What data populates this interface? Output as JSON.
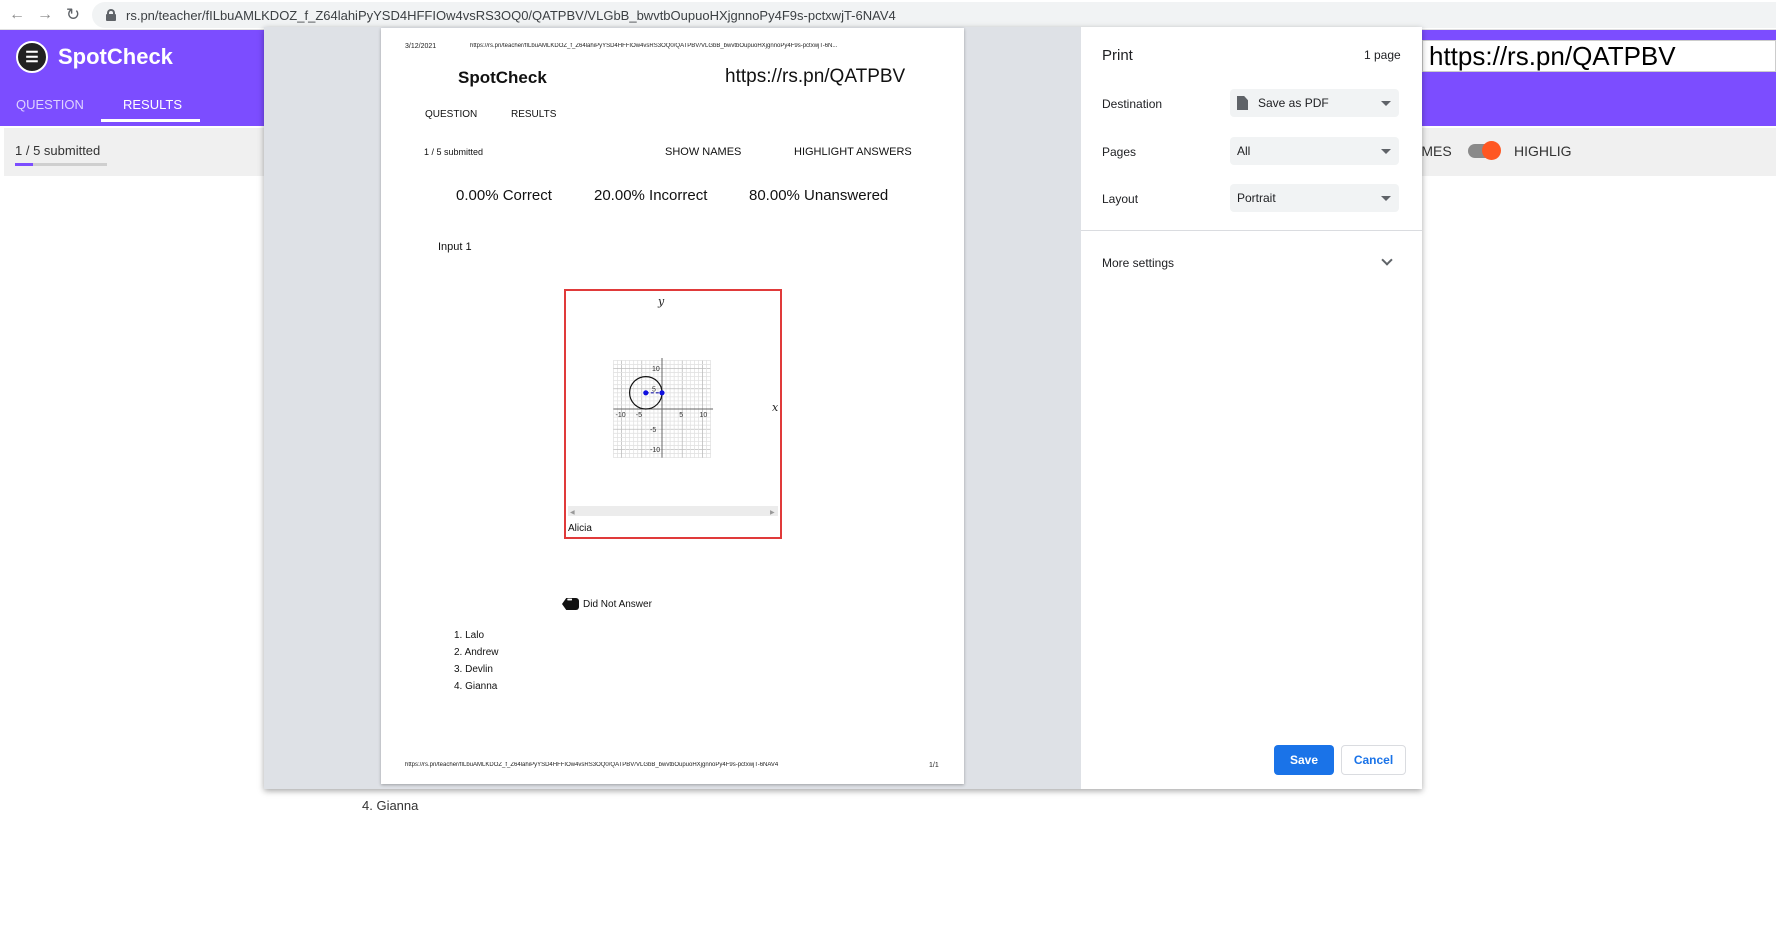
{
  "browser": {
    "url": "rs.pn/teacher/fILbuAMLKDOZ_f_Z64lahiPyYSD4HFFIOw4vsRS3OQ0/QATPBV/VLGbB_bwvtbOupuoHXjgnnoPy4F9s-pctxwjT-6NAV4"
  },
  "app": {
    "brand": "SpotCheck",
    "tabs": [
      "QUESTION",
      "RESULTS"
    ],
    "submitted": "1 / 5 submitted",
    "submitted_fraction": 0.2,
    "share_url": "https://rs.pn/QATPBV",
    "show_names_partial": "AMES",
    "highlight_partial": "HIGHLIG",
    "behind_list_item": "4. Gianna"
  },
  "print_preview": {
    "header_date": "3/12/2021",
    "header_url": "https://rs.pn/teacher/fILbuAMLKDOZ_f_Z64lahiPyYSD4HFFIOw4vsRS3OQ0/QATPBV/VLGbB_bwvtbOupuoHXjgnnoPy4F9s-pctxwjT-6N...",
    "brand": "SpotCheck",
    "share_url": "https://rs.pn/QATPBV",
    "tab_question": "QUESTION",
    "tab_results": "RESULTS",
    "submitted": "1 / 5 submitted",
    "show_names": "SHOW NAMES",
    "highlight_answers": "HIGHLIGHT ANSWERS",
    "correct": "0.00% Correct",
    "incorrect": "20.00% Incorrect",
    "unanswered": "80.00% Unanswered",
    "input_label": "Input 1",
    "graph": {
      "x_axis_label": "x",
      "y_axis_label": "y",
      "x_ticks": [
        "-10",
        "-5",
        "5",
        "10"
      ],
      "y_ticks": [
        "10",
        "5",
        "-5",
        "-10"
      ],
      "circle_center": [
        -4,
        4
      ],
      "circle_radius": 4,
      "radius_point": [
        0,
        4
      ],
      "student_name": "Alicia"
    },
    "did_not_answer_label": "Did Not Answer",
    "did_not_answer": [
      "1. Lalo",
      "2. Andrew",
      "3. Devlin",
      "4. Gianna"
    ],
    "footer_url": "https://rs.pn/teacher/fILbuAMLKDOZ_f_Z64lahiPyYSD4HFFIOw4vsRS3OQ0/QATPBV/VLGbB_bwvtbOupuoHXjgnnoPy4F9s-pctxwjT-6NAV4",
    "footer_page": "1/1"
  },
  "print_settings": {
    "title": "Print",
    "page_count": "1 page",
    "destination_label": "Destination",
    "destination_value": "Save as PDF",
    "pages_label": "Pages",
    "pages_value": "All",
    "layout_label": "Layout",
    "layout_value": "Portrait",
    "more_settings": "More settings",
    "save_button": "Save",
    "cancel_button": "Cancel"
  }
}
